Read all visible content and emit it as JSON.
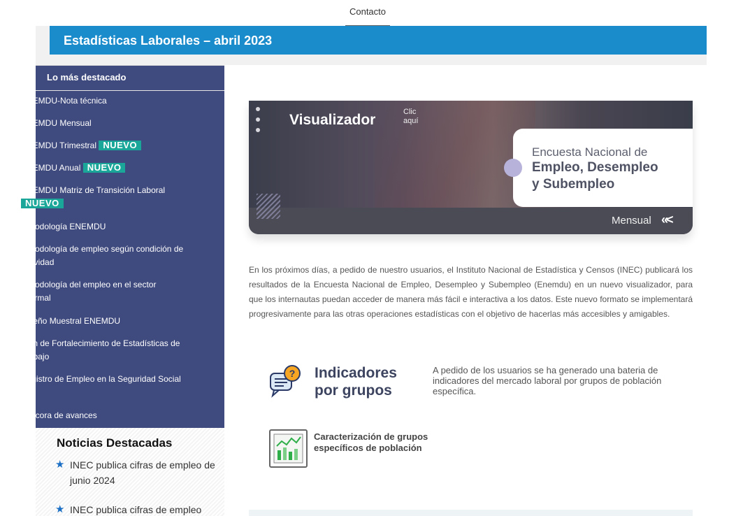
{
  "nav": {
    "contact_label": "Contacto"
  },
  "banner": {
    "title": "Estadísticas Laborales – abril 2023"
  },
  "sidebar": {
    "heading": "Lo más destacado",
    "badge_label": "NUEVO",
    "items": [
      {
        "label": "ENEMDU-Nota técnica"
      },
      {
        "label": "ENEMDU Mensual"
      },
      {
        "label": "ENEMDU Trimestral",
        "badge": "NUEVO"
      },
      {
        "label": "ENEMDU Anual",
        "badge": "NUEVO"
      },
      {
        "label": "ENEMDU Matriz de Transición Laboral",
        "badge": "NUEVO"
      },
      {
        "label": "Metodología ENEMDU"
      },
      {
        "label": "Metodología de empleo según condición de actividad"
      },
      {
        "label": "Metodología del empleo en el sector informal"
      },
      {
        "label": "Diseño Muestral ENEMDU"
      },
      {
        "label": "Plan de Fortalecimiento de Estadísticas de Trabajo"
      },
      {
        "label": "Registro de Empleo en la Seguridad Social"
      },
      {
        "label": "Bitácora de avances"
      }
    ]
  },
  "news": {
    "heading": "Noticias Destacadas",
    "items": [
      {
        "text": "INEC publica cifras de empleo de junio 2024"
      },
      {
        "text": "INEC publica cifras de empleo"
      }
    ]
  },
  "hero": {
    "visualizador": "Visualizador",
    "click": "Clic aquí",
    "line1": "Encuesta Nacional de",
    "line2": "Empleo, Desempleo",
    "line3": "y Subempleo",
    "mensual": "Mensual",
    "chevrons": "«<"
  },
  "intro": "En los próximos días, a pedido de nuestro usuarios, el Instituto Nacional de Estadística y Censos (INEC) publicará los resultados de la Encuesta Nacional de Empleo, Desempleo y Subempleo (Enemdu) en un nuevo visualizador, para que los internautas puedan acceder de manera más fácil e interactiva a los datos. Este nuevo formato se implementará progresivamente para las otras operaciones estadísticas con el objetivo de hacerlas más accesibles y amigables.",
  "indicators": {
    "title": "Indicadores por grupos",
    "description": "A pedido de los usuarios se ha generado una bateria de indicadores del mercado laboral por grupos de población específica."
  },
  "characterization": {
    "title": "Caracterización de grupos específicos de población"
  },
  "colors": {
    "banner": "#1a8bcb",
    "sidebar": "#3f4a7e",
    "badge": "#1aa79a",
    "star": "#1a6fc4"
  }
}
